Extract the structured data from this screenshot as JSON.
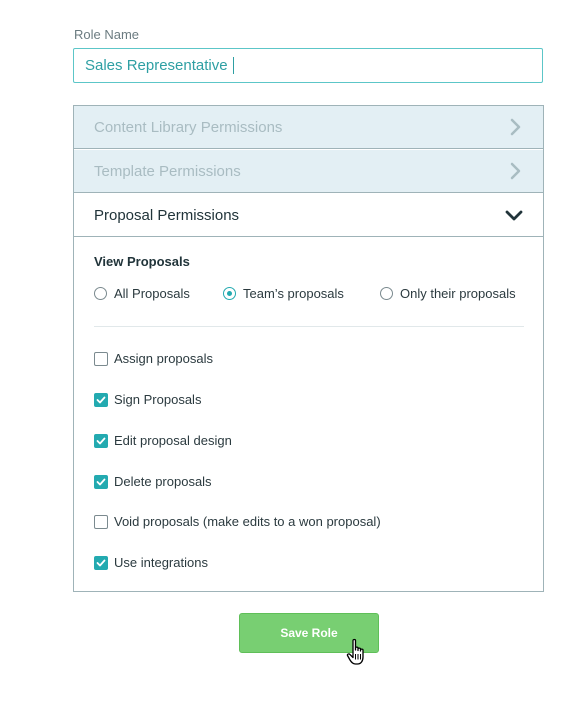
{
  "role": {
    "label": "Role Name",
    "value": "Sales Representative"
  },
  "accordion": {
    "content_library": "Content Library Permissions",
    "template": "Template Permissions",
    "proposal": "Proposal Permissions"
  },
  "view_proposals": {
    "title": "View Proposals",
    "options": [
      "All Proposals",
      "Team’s proposals",
      "Only their proposals"
    ],
    "selected": "Team’s proposals"
  },
  "permissions": [
    {
      "label": "Assign proposals",
      "checked": false
    },
    {
      "label": "Sign Proposals",
      "checked": true
    },
    {
      "label": "Edit proposal design",
      "checked": true
    },
    {
      "label": "Delete proposals",
      "checked": true
    },
    {
      "label": "Void proposals (make edits to a won proposal)",
      "checked": false
    },
    {
      "label": "Use integrations",
      "checked": true
    }
  ],
  "save_label": "Save Role",
  "colors": {
    "accent": "#23aab0",
    "save_button": "#78cf72",
    "collapsed_bg": "#e3eff4"
  }
}
